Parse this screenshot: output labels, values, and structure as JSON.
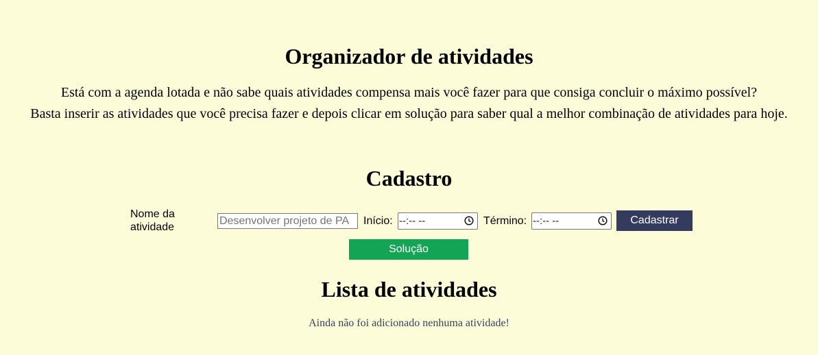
{
  "header": {
    "title": "Organizador de atividades",
    "intro_line1": "Está com a agenda lotada e não sabe quais atividades compensa mais você fazer para que consiga concluir o máximo possível?",
    "intro_line2": "Basta inserir as atividades que você precisa fazer e depois clicar em solução para saber qual a melhor combinação de atividades para hoje."
  },
  "register": {
    "title": "Cadastro",
    "name_label": "Nome da atividade",
    "name_placeholder": "Desenvolver projeto de PA",
    "name_value": "",
    "start_label": "Início:",
    "start_value": "--:-- --",
    "end_label": "Término:",
    "end_value": "--:-- --",
    "submit_label": "Cadastrar",
    "solution_label": "Solução"
  },
  "activities": {
    "title": "Lista de atividades",
    "empty_message": "Ainda não foi adicionado nenhuma atividade!",
    "items": []
  },
  "colors": {
    "background": "#fdfcd9",
    "register_button": "#333b5e",
    "solution_button": "#13a455"
  },
  "icons": {
    "time_picker": "clock-icon"
  }
}
